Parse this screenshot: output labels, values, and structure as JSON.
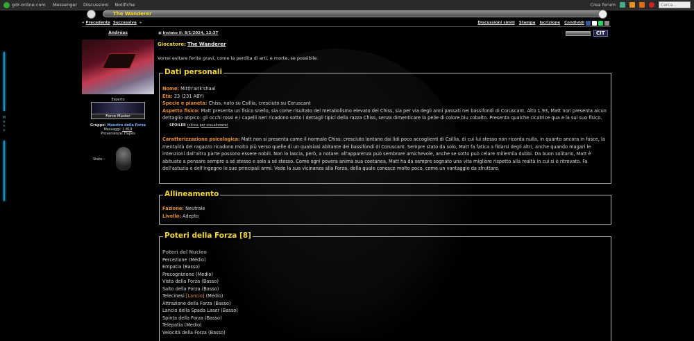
{
  "topbar": {
    "site": "gdr-online.com",
    "nav": [
      "Messenger",
      "Discussioni",
      "Notifiche"
    ],
    "create_forum": "Crea forum",
    "search_placeholder": "Cerca..."
  },
  "sidebar_tab": {
    "label": "Menu"
  },
  "thread": {
    "title": "The Wanderer",
    "prev": "Precedente",
    "next": "Successiva",
    "actions": [
      "Discussioni simili",
      "Stampa",
      "Iscrizione",
      "Condividi"
    ]
  },
  "author": {
    "name": "Andréas",
    "rank_label": "Esperto",
    "badge": "Force Master",
    "group_label": "Gruppo:",
    "group": "Maestro della Forza",
    "messages_label": "Messaggi:",
    "messages": "1.819",
    "origin_label": "Provenienza:",
    "origin": "Hapes",
    "status_label": "Stato:"
  },
  "post": {
    "sent_label": "Inviato il:",
    "sent_date": "8/1/2024, 12:37",
    "quote_label": "CIT",
    "player_label": "Giocatore:",
    "player_name": "The Wanderer",
    "intro": "Vorrei evitare ferite gravi, come la perdita di arti, e morte, se possibile."
  },
  "personal": {
    "legend": "Dati personali",
    "name_k": "Nome:",
    "name_v": " Mitth'arik'shaal",
    "age_k": "Età:",
    "age_v": " 23 (231 ABY)",
    "species_k": "Specie e pianeta:",
    "species_v": " Chiss, nato su Csillia, cresciuto su Coruscant",
    "phys_k": "Aspetto fisico:",
    "phys_v": " Matt presenta un fisico snello, sia come risultato del metabolismo elevato dei Chiss, sia per via degli anni passati nei bassifondi di Coruscant. Alto 1.93, Matt non presenta alcun dettaglio atipico: gli occhi rossi e i capelli neri ricadono sotto i dettagli tipici della razza Chiss, senza dimenticare la pelle di colore blu cobalto. Presenta qualche cicatrice qua e la sul suo fisico.",
    "spoiler_label": "SPOILER",
    "spoiler_link": "(clicca per visualizzare)",
    "psych_k": "Caratterizzazione psicologica:",
    "psych_v": " Matt non si presenta come il normale Chiss: cresciuto lontano dai lidi poco accoglienti di Csillia, di cui lui stesso non ricorda nulla, in quanto ancora in fasce, la mentalità del ragazzo ricadono molto più verso quelle di un qualsiasi abitante dei bassifondi di Coruscant. Sempre stato da solo, Matt fa fatica a fidarsi degli altri, anche quando magari le intenzioni dall'altra parte possono essere nobili. Non lo lascia, però, a notare: all'apparenza può sembrare amichevole, anche se sotto può celare millemila dubbi. Da buon solitario, Matt è abituato a pensare sempre a sé stesso e solo a sé stesso. Come ogni povera anima sua coetanea, Matt ha da sempre sognato una vita migliore rispetto alla realtà in cui si è ritrovato. Fa dell'astuzia e dell'ingegno le sue principali armi. Vede la sua vicinanza alla Forza, della quale conosce molto poco, come un vantaggio da sfruttare."
  },
  "alignment": {
    "legend": "Allineamento",
    "faction_k": "Fazione:",
    "faction_v": " Neutrale",
    "level_k": "Livello:",
    "level_v": " Adepto"
  },
  "powers": {
    "legend": "Poteri della Forza [8]",
    "heading": "Poteri del Nucleo",
    "items": [
      "Percezione (Medio)",
      "Empatia (Basso)",
      "Precognizione (Medio)",
      "Vista della Forza (Basso)",
      "Salto della Forza (Basso)",
      "Telecinesi ",
      "Attrazione della Forza (Basso)",
      "Lancio della Spada Laser (Basso)",
      "Spinta della Forza (Basso)",
      "Telepatia (Medio)",
      "Velocità della Forza (Basso)"
    ],
    "lancio": "[Lancio]",
    "medio": " (Medio)"
  },
  "colors": {
    "accent": "#f2d630",
    "key": "#e98f2a",
    "group": "#7ab0ff",
    "menu": "#1a8fc8"
  }
}
